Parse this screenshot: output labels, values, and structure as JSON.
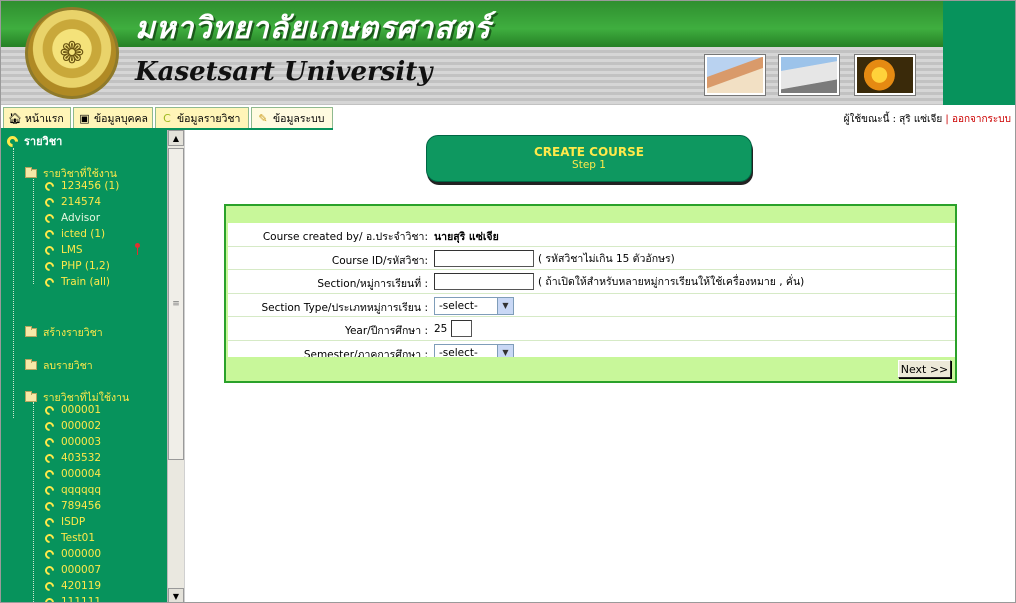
{
  "header": {
    "thai_title": "มหาวิทยาลัยเกษตรศาสตร์",
    "english_title": "Kasetsart University"
  },
  "tabs": [
    {
      "label": "หน้าแรก",
      "icon": "home-icon"
    },
    {
      "label": "ข้อมูลบุคคล",
      "icon": "person-icon"
    },
    {
      "label": "ข้อมูลรายวิชา",
      "icon": "course-icon"
    },
    {
      "label": "ข้อมูลระบบ",
      "icon": "wrench-icon"
    }
  ],
  "userbar": {
    "prefix": "ผู้ใช้ขณะนี้ : สุริ แซ่เจีย",
    "separator": "|",
    "logout": "ออกจากระบบ"
  },
  "sidebar": {
    "root": "รายวิชา",
    "active_folder": "รายวิชาที่ใช้งาน",
    "active_items": [
      "123456 (1)",
      "214574",
      "Advisor",
      "icted (1)",
      "LMS",
      "PHP (1,2)",
      "Train (all)"
    ],
    "create_folder": "สร้างรายวิชา",
    "delete_folder": "ลบรายวิชา",
    "inactive_folder": "รายวิชาที่ไม่ใช้งาน",
    "inactive_items": [
      "000001",
      "000002",
      "000003",
      "403532",
      "000004",
      "qqqqqq",
      "789456",
      "ISDP",
      "Test01",
      "000000",
      "000007",
      "420119",
      "111111"
    ]
  },
  "banner": {
    "title": "CREATE COURSE",
    "step": "Step 1"
  },
  "form": {
    "created_by_label": "Course created by/ อ.ประจำวิชา:",
    "created_by_value": "นายสุริ แซ่เจีย",
    "course_id_label": "Course ID/รหัสวิชา:",
    "course_id_value": "",
    "course_id_hint": "( รหัสวิชาไม่เกิน 15 ตัวอักษร)",
    "section_label": "Section/หมู่การเรียนที่ :",
    "section_value": "",
    "section_hint": "( ถ้าเปิดให้สำหรับหลายหมู่การเรียนให้ใช้เครื่องหมาย , คั่น)",
    "section_type_label": "Section Type/ประเภทหมู่การเรียน :",
    "section_type_value": "-select-",
    "year_label": "Year/ปีการศึกษา :",
    "year_prefix": "25",
    "year_value": "",
    "semester_label": "Semester/ภาคการศึกษา :",
    "semester_value": "-select-",
    "next_label": "Next >>"
  },
  "colors": {
    "sidebar_green": "#07935c",
    "folder_text": "#ffe94a",
    "form_border": "#2aa12a",
    "form_bg": "#c8f79a",
    "logout_red": "#cc0000"
  }
}
